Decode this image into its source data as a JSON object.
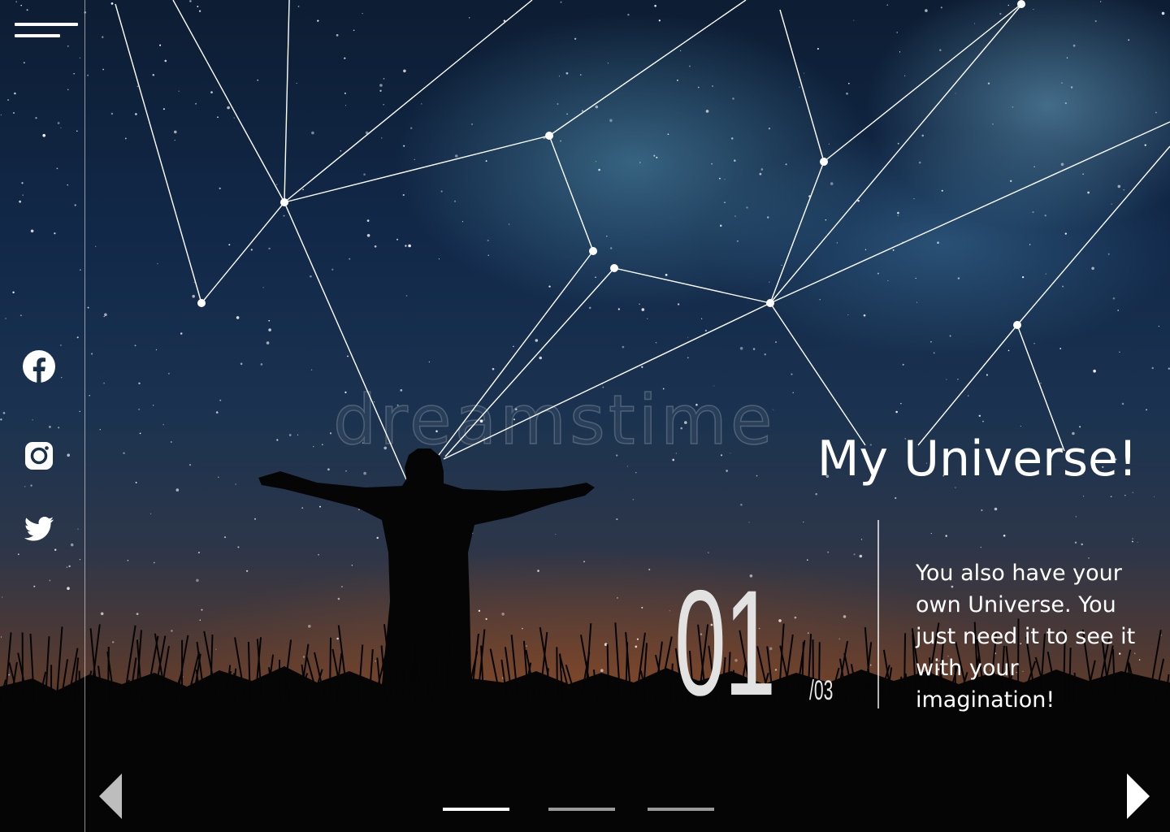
{
  "menu": {
    "icon": "hamburger-menu-icon"
  },
  "social_links": [
    {
      "name": "Facebook",
      "icon": "facebook-icon"
    },
    {
      "name": "Instagram",
      "icon": "instagram-icon"
    },
    {
      "name": "Twitter",
      "icon": "twitter-icon"
    }
  ],
  "hero": {
    "title": "My Universe!",
    "description": "You also have your own Universe. You just need it to see it with your imagination!"
  },
  "slider": {
    "current": "01",
    "total": "/03",
    "slide_count": 3,
    "active_index": 0,
    "prev_icon": "triangle-left-icon",
    "next_icon": "triangle-right-icon"
  },
  "watermark": {
    "text": "dreamstime"
  },
  "colors": {
    "text": "#ffffff",
    "slide_number": "#e2e2e2",
    "indicator_active": "#ffffff",
    "indicator_inactive": "#9a9a9a",
    "constellation_line": "#ffffff"
  }
}
